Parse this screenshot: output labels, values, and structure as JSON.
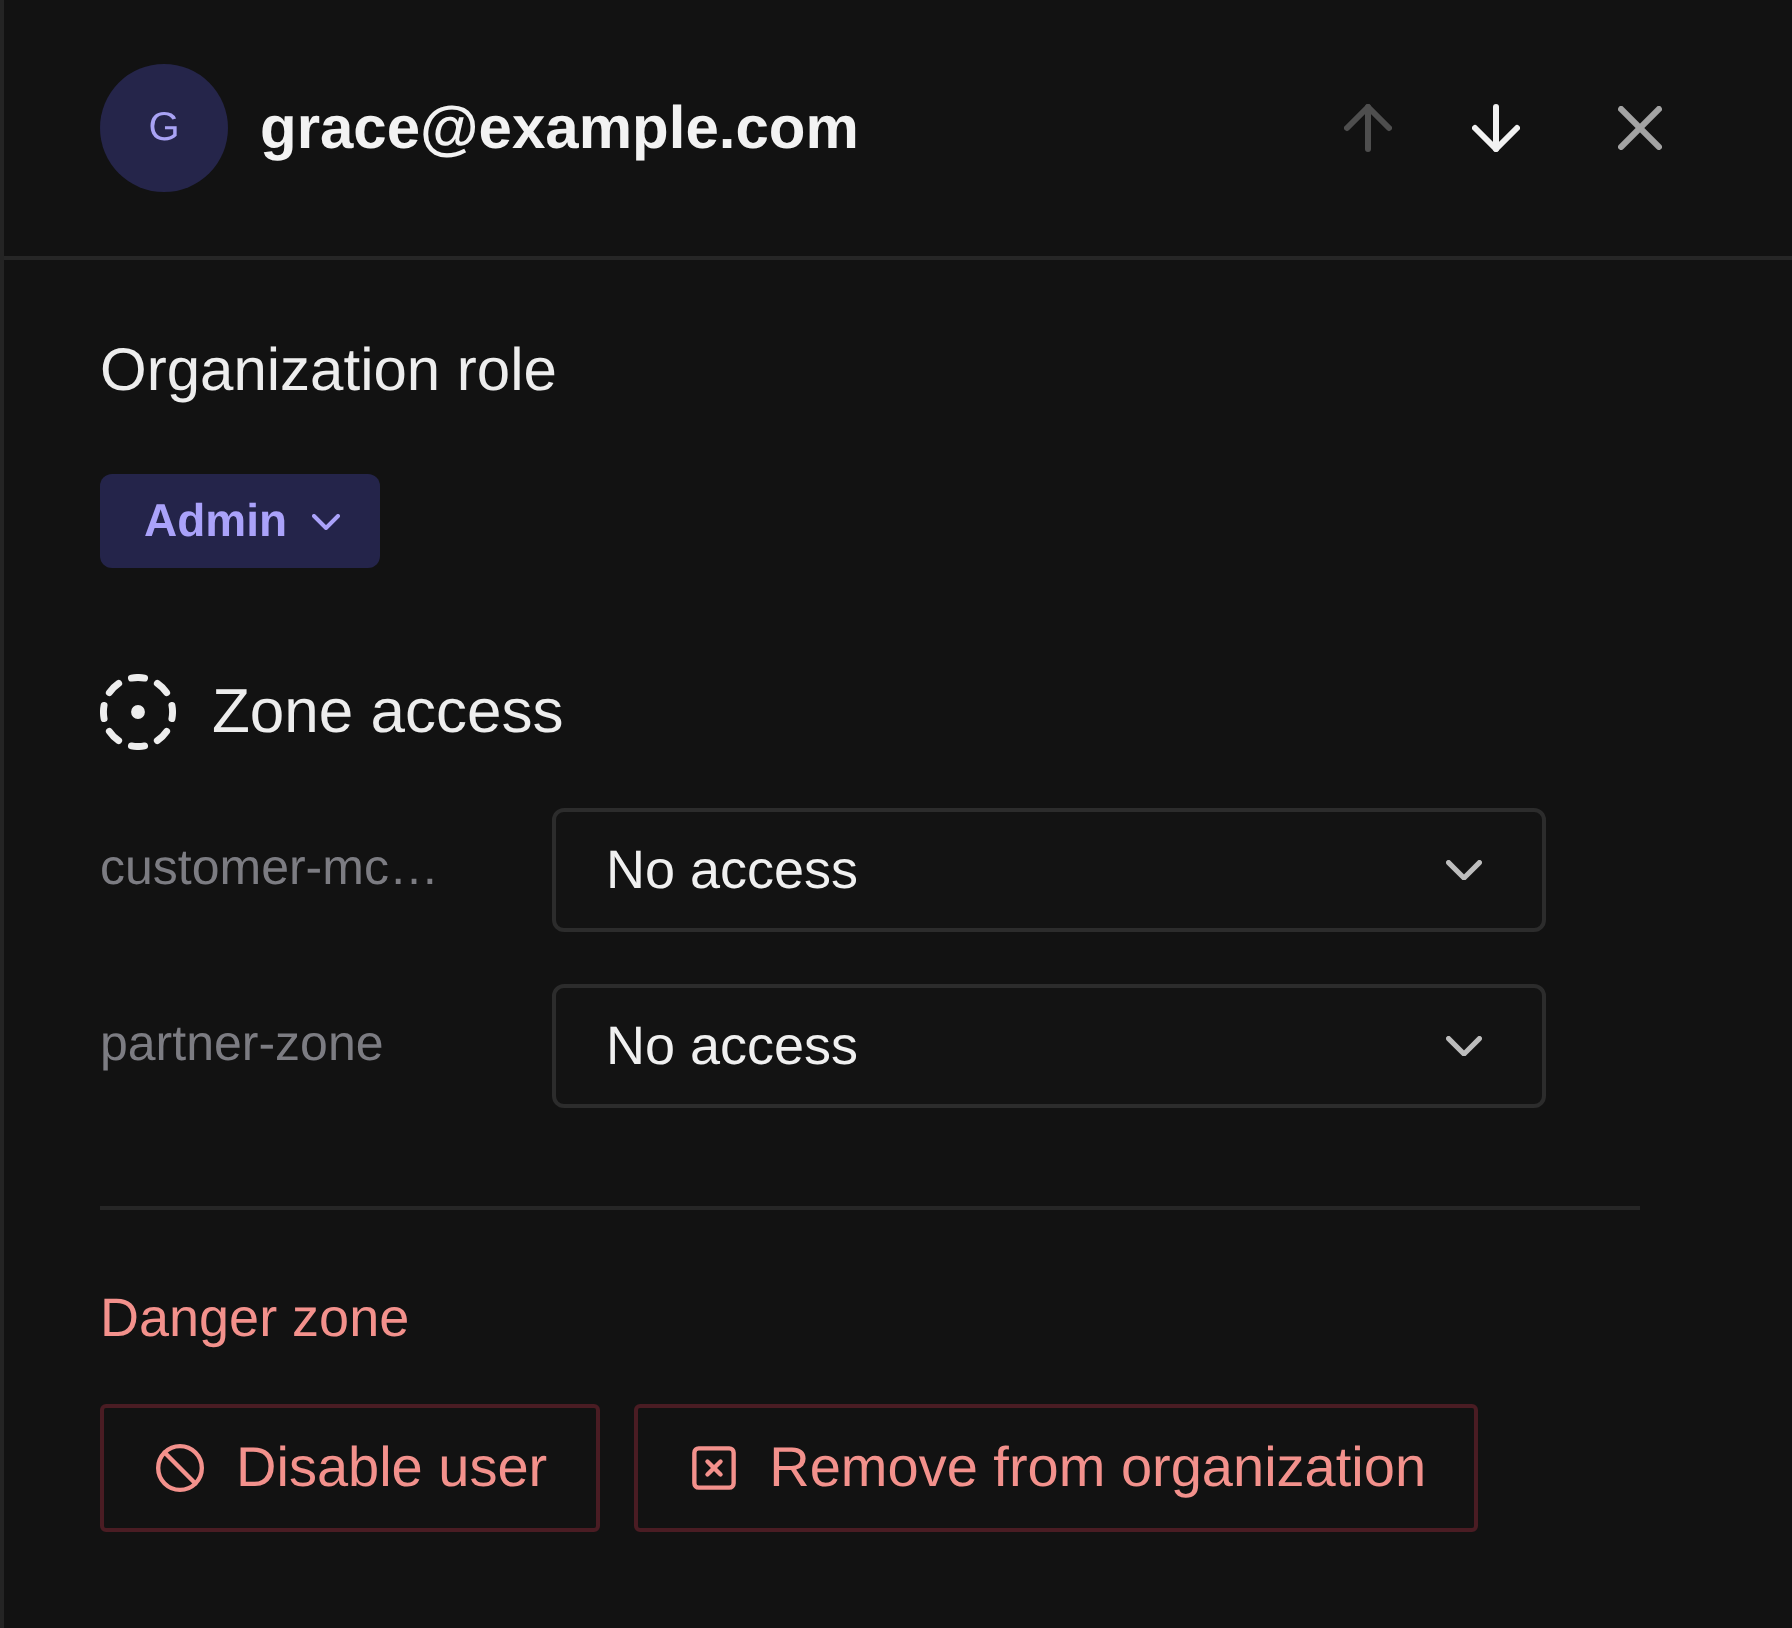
{
  "header": {
    "avatar_initial": "G",
    "email": "grace@example.com",
    "buttons": [
      {
        "kind": "up",
        "disabled": true
      },
      {
        "kind": "down",
        "disabled": false
      },
      {
        "kind": "close",
        "disabled": false
      }
    ]
  },
  "organization_role": {
    "title": "Organization role",
    "role": "Admin"
  },
  "zone_access": {
    "title": "Zone access",
    "zones": [
      {
        "name": "customer-mc…",
        "access": "No access"
      },
      {
        "name": "partner-zone",
        "access": "No access"
      }
    ]
  },
  "danger_zone": {
    "title": "Danger zone",
    "actions": [
      {
        "kind": "disable",
        "label": "Disable user"
      },
      {
        "kind": "remove",
        "label": "Remove from organization"
      }
    ]
  }
}
